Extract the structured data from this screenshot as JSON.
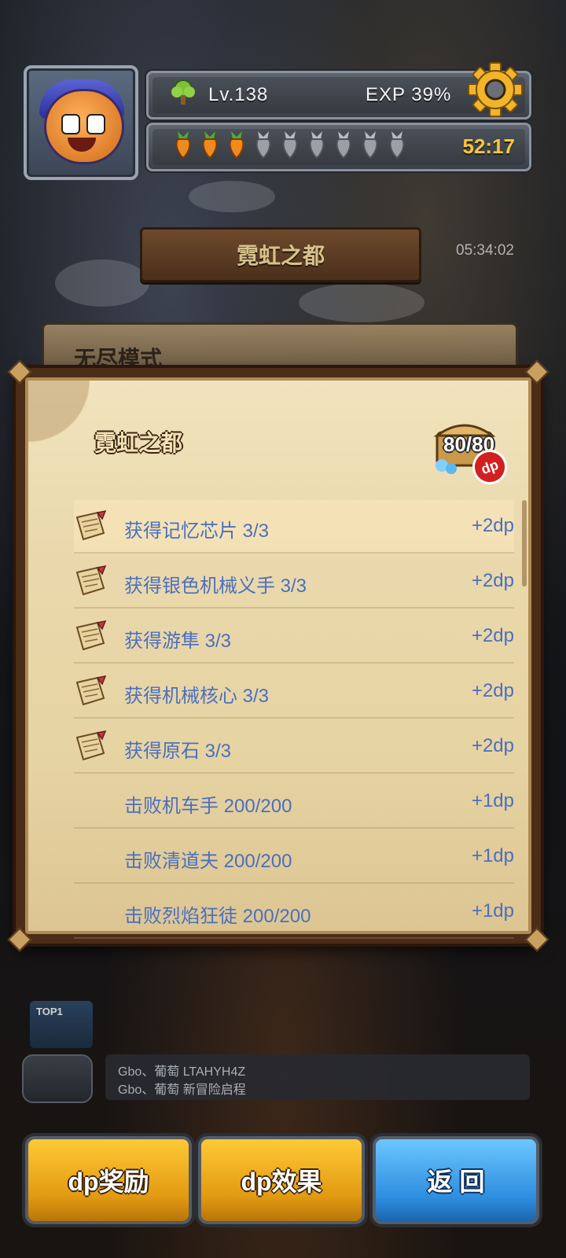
{
  "hud": {
    "level": "Lv.138",
    "exp": "EXP 39%",
    "timer": "52:17",
    "carrots": [
      "full",
      "full",
      "full",
      "empty",
      "empty",
      "empty",
      "empty",
      "empty",
      "empty"
    ],
    "icons": {
      "level": "tree-icon",
      "settings": "gear-icon",
      "stamina": "carrot-icon"
    }
  },
  "map": {
    "title": "霓虹之都",
    "timer": "05:34:02",
    "endless_label": "无尽模式"
  },
  "modal": {
    "title": "霓虹之都",
    "chest_count": "80/80",
    "dp_badge": "dp",
    "tasks": [
      {
        "text": "获得记忆芯片 3/3",
        "reward": "+2dp",
        "icon": true
      },
      {
        "text": "获得银色机械义手 3/3",
        "reward": "+2dp",
        "icon": true
      },
      {
        "text": "获得游隼 3/3",
        "reward": "+2dp",
        "icon": true
      },
      {
        "text": "获得机械核心 3/3",
        "reward": "+2dp",
        "icon": true
      },
      {
        "text": "获得原石 3/3",
        "reward": "+2dp",
        "icon": true
      },
      {
        "text": "击败机车手 200/200",
        "reward": "+1dp",
        "icon": false
      },
      {
        "text": "击败清道夫 200/200",
        "reward": "+1dp",
        "icon": false
      },
      {
        "text": "击败烈焰狂徒 200/200",
        "reward": "+1dp",
        "icon": false
      }
    ]
  },
  "chat": {
    "badge": "TOP1",
    "lines": [
      "Gbo、葡萄 LTAHYH4Z",
      "Gbo、葡萄 新冒险启程"
    ]
  },
  "buttons": {
    "dp_reward": "dp奖励",
    "dp_effect": "dp效果",
    "back": "返 回"
  },
  "colors": {
    "task_text": "#4b6fbf",
    "timer": "#ffc437",
    "gold_button": "#e29a12",
    "blue_button": "#2f8fe0"
  }
}
